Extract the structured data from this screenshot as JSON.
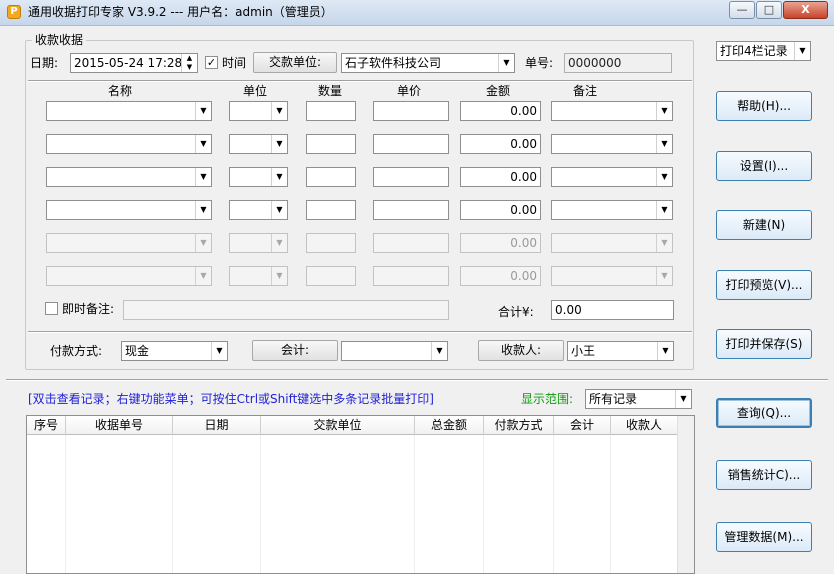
{
  "window": {
    "title": "通用收据打印专家 V3.9.2 --- 用户名：admin（管理员）",
    "icon_glyph": "P",
    "controls": {
      "minimize": "—",
      "maximize": "□",
      "close": "X"
    }
  },
  "receipt": {
    "group_title": "收款收据",
    "date_label": "日期:",
    "date_value": "2015-05-24 17:28:",
    "time_label": "时间",
    "payer_button": "交款单位:",
    "payer_value": "石子软件科技公司",
    "no_label": "单号:",
    "no_value": "0000000"
  },
  "items": {
    "headers": [
      "名称",
      "单位",
      "数量",
      "单价",
      "金额",
      "备注"
    ],
    "rows": [
      {
        "amount": "0.00",
        "enabled": true
      },
      {
        "amount": "0.00",
        "enabled": true
      },
      {
        "amount": "0.00",
        "enabled": true
      },
      {
        "amount": "0.00",
        "enabled": true
      },
      {
        "amount": "0.00",
        "enabled": false
      },
      {
        "amount": "0.00",
        "enabled": false
      }
    ]
  },
  "note": {
    "label": "即时备注:",
    "value": ""
  },
  "total": {
    "label": "合计¥:",
    "value": "0.00"
  },
  "payment": {
    "method_label": "付款方式:",
    "method_value": "现金",
    "accountant_button": "会计:",
    "accountant_value": "",
    "payee_button": "收款人:",
    "payee_value": "小王"
  },
  "records": {
    "hint": "[双击查看记录；右键功能菜单；可按住Ctrl或Shift键选中多条记录批量打印]",
    "range_label": "显示范围:",
    "range_value": "所有记录",
    "columns": [
      "序号",
      "收据单号",
      "日期",
      "交款单位",
      "总金额",
      "付款方式",
      "会计",
      "收款人"
    ]
  },
  "sidebar": {
    "print_select": "打印4栏记录",
    "buttons": [
      "帮助(H)...",
      "设置(I)...",
      "新建(N)",
      "打印预览(V)...",
      "打印并保存(S)",
      "查询(Q)...",
      "销售统计C)...",
      "管理数据(M)..."
    ]
  }
}
